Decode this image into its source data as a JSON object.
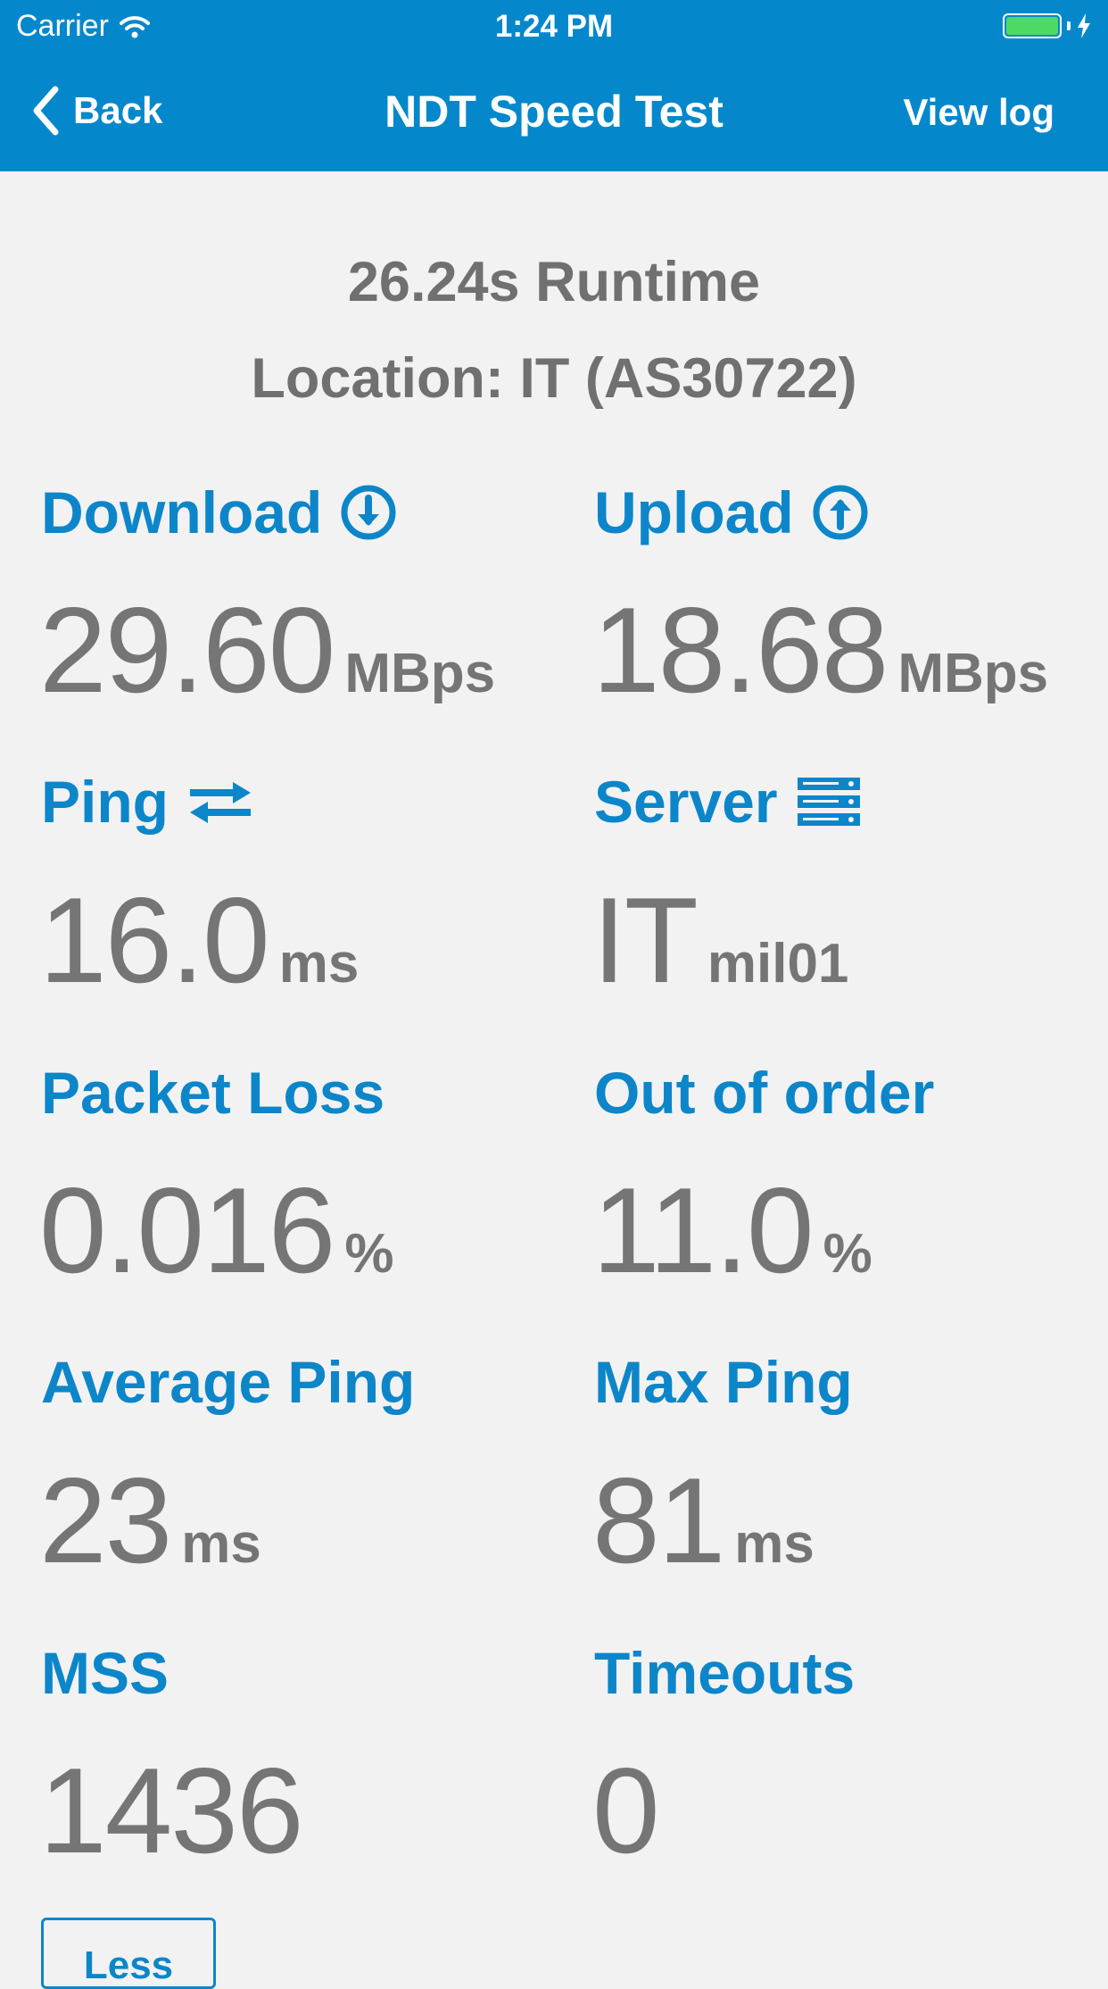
{
  "status_bar": {
    "carrier": "Carrier",
    "time": "1:24 PM"
  },
  "nav": {
    "back_label": "Back",
    "title": "NDT Speed Test",
    "view_log_label": "View log"
  },
  "summary": {
    "runtime": "26.24s Runtime",
    "location": "Location: IT (AS30722)"
  },
  "metrics": {
    "download": {
      "label": "Download",
      "value": "29.60",
      "unit": "MBps"
    },
    "upload": {
      "label": "Upload",
      "value": "18.68",
      "unit": "MBps"
    },
    "ping": {
      "label": "Ping",
      "value": "16.0",
      "unit": "ms"
    },
    "server": {
      "label": "Server",
      "value": "IT",
      "unit": "mil01"
    },
    "packet_loss": {
      "label": "Packet Loss",
      "value": "0.016",
      "unit": "%"
    },
    "out_of_order": {
      "label": "Out of order",
      "value": "11.0",
      "unit": "%"
    },
    "average_ping": {
      "label": "Average Ping",
      "value": "23",
      "unit": "ms"
    },
    "max_ping": {
      "label": "Max Ping",
      "value": "81",
      "unit": "ms"
    },
    "mss": {
      "label": "MSS",
      "value": "1436"
    },
    "timeouts": {
      "label": "Timeouts",
      "value": "0"
    }
  },
  "less_button_label": "Less",
  "colors": {
    "nav_bar": "#0588cb",
    "accent": "#0c86c9",
    "value_text": "#757575",
    "background": "#f2f2f3"
  },
  "icons": [
    "wifi-icon",
    "battery-icon",
    "charging-bolt-icon",
    "chevron-left-icon",
    "download-circle-icon",
    "upload-circle-icon",
    "swap-arrows-icon",
    "server-icon"
  ]
}
